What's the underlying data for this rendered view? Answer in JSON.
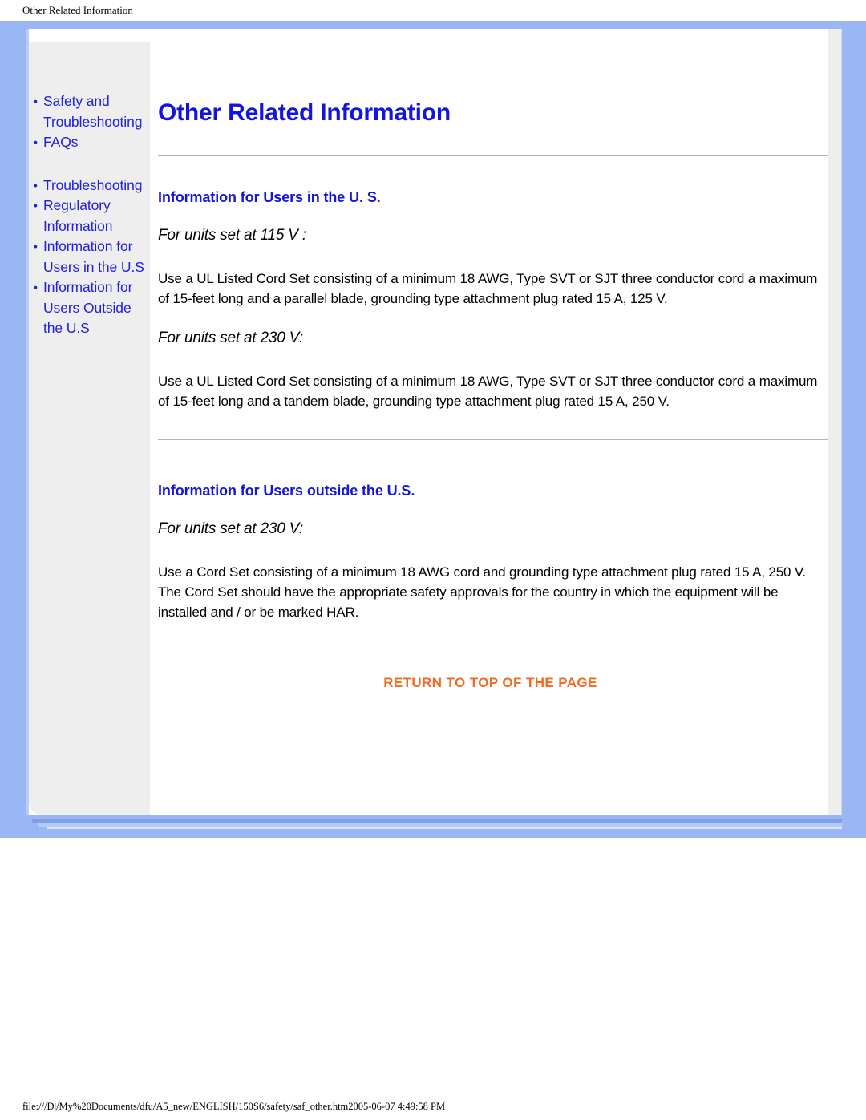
{
  "print": {
    "header_title": "Other Related Information",
    "footer_path": "file:///D|/My%20Documents/dfu/A5_new/ENGLISH/150S6/safety/saf_other.htm2005-06-07 4:49:58 PM"
  },
  "colors": {
    "frame_blue": "#9ab6f5",
    "link_blue": "#2020e0",
    "heading_blue": "#1414e0",
    "return_orange": "#f26a21",
    "sidebar_gray": "#eeeeee"
  },
  "sidebar": {
    "group1": [
      {
        "label": "Safety and Troubleshooting"
      },
      {
        "label": "FAQs"
      }
    ],
    "group2": [
      {
        "label": "Troubleshooting"
      },
      {
        "label": "Regulatory Information"
      },
      {
        "label": "Information for Users in the U.S"
      },
      {
        "label": "Information for Users Outside the U.S"
      }
    ]
  },
  "main": {
    "title": "Other Related Information",
    "sections": [
      {
        "heading": "Information for Users in the U. S.",
        "blocks": [
          {
            "sub": "For units set at 115 V :",
            "text": "Use a UL Listed Cord Set consisting of a minimum 18 AWG, Type SVT or SJT three conductor cord a maximum of 15-feet long and a parallel blade, grounding type attachment plug rated 15 A, 125 V."
          },
          {
            "sub": "For units set at 230 V:",
            "text": "Use a UL Listed Cord Set consisting of a minimum 18 AWG, Type SVT or SJT three conductor cord a maximum of 15-feet long and a tandem blade, grounding type attachment plug rated 15 A, 250 V."
          }
        ]
      },
      {
        "heading": "Information for Users outside the U.S.",
        "blocks": [
          {
            "sub": "For units set at 230 V:",
            "text": "Use a Cord Set consisting of a minimum 18 AWG cord and grounding type attachment plug rated 15 A, 250 V. The Cord Set should have the appropriate safety approvals for the country in which the equipment will be installed and / or be marked HAR."
          }
        ]
      }
    ],
    "return_to_top": "RETURN TO TOP OF THE PAGE"
  }
}
